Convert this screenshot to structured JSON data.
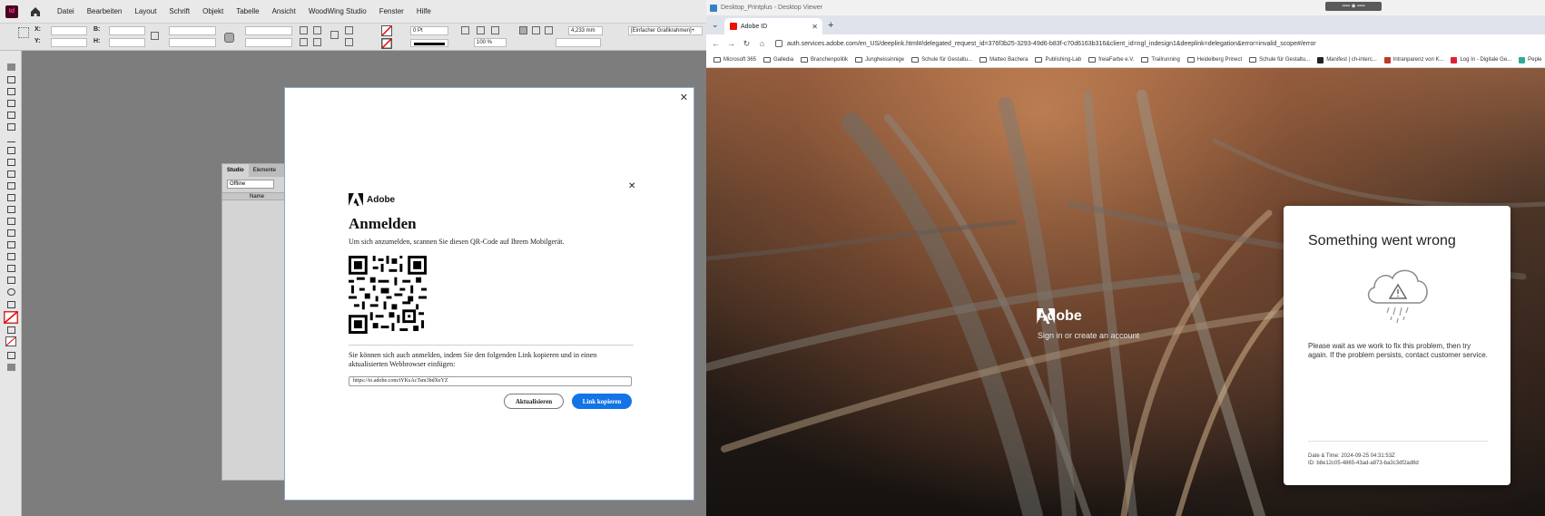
{
  "indesign": {
    "logo": "Id",
    "menu": [
      "Datei",
      "Bearbeiten",
      "Layout",
      "Schrift",
      "Objekt",
      "Tabelle",
      "Ansicht",
      "WoodWing Studio",
      "Fenster",
      "Hilfe"
    ],
    "control": {
      "x_label": "X:",
      "y_label": "Y:",
      "b_label": "B:",
      "h_label": "H:",
      "stroke_value": "0 Pt",
      "zoom_value": "100 %",
      "size_value": "4,233 mm",
      "frame_style": "[Einfacher Grafikrahmen]+"
    },
    "studio_panel": {
      "tab_studio": "Studio",
      "tab_elements": "Elemente",
      "status_select": "Offline",
      "column_name": "Name"
    }
  },
  "login_dialog": {
    "brand": "Adobe",
    "title": "Anmelden",
    "subtitle": "Um sich anzumelden, scannen Sie diesen QR-Code auf Ihrem Mobilgerät.",
    "instructions": "Sie können sich auch anmelden, indem Sie den folgenden Link kopieren und in einen aktualisierten Webbrowser einfügen:",
    "link": "https://to.adobe.com/tYKsAcTsm3bdXeYZ",
    "refresh_button": "Aktualisieren",
    "copy_button": "Link kopieren"
  },
  "browser": {
    "viewer_title": "Desktop_Printplus - Desktop Viewer",
    "tab_title": "Adobe ID",
    "url": "auth.services.adobe.com/en_US/deeplink.html#/delegated_request_id=376f3b25-3293-49d6-b83f-c70d6163b316&client_id=ngl_indesign1&deeplink=delegation&error=invalid_scope#/error",
    "bookmarks": [
      {
        "label": "Microsoft 365",
        "kind": "folder"
      },
      {
        "label": "Galledia",
        "kind": "folder"
      },
      {
        "label": "Branchenpolitik",
        "kind": "folder"
      },
      {
        "label": "Jungheissinnige",
        "kind": "folder"
      },
      {
        "label": "Schule für Gestaltu...",
        "kind": "folder"
      },
      {
        "label": "Matteo Bachera",
        "kind": "folder"
      },
      {
        "label": "Publishing-Lab",
        "kind": "folder"
      },
      {
        "label": "freiaFarbe e.V.",
        "kind": "folder"
      },
      {
        "label": "Trailrunning",
        "kind": "folder"
      },
      {
        "label": "Heidelberg Prinect",
        "kind": "folder"
      },
      {
        "label": "Schule für Gestaltu...",
        "kind": "folder"
      },
      {
        "label": "Manifest | ch-interc...",
        "kind": "page"
      },
      {
        "label": "Intranparenz von K...",
        "kind": "page"
      },
      {
        "label": "Log In - Digitale Ge...",
        "kind": "page"
      },
      {
        "label": "Peple",
        "kind": "page"
      }
    ],
    "hero_brand": "Adobe",
    "hero_subtitle": "Sign in or create an account",
    "error_card": {
      "title": "Something went wrong",
      "message": "Please wait as we work to fix this problem, then try again. If the problem persists, contact customer service.",
      "date_line": "Date & Time: 2024-09-25 04:31:53Z",
      "id_line": "ID: b8e12c05-4865-43ad-a873-ba3c3df2ad8d"
    }
  },
  "colors": {
    "adobe_red": "#eb1000",
    "copy_button_blue": "#1473e6",
    "indesign_dark": "#49021f"
  }
}
